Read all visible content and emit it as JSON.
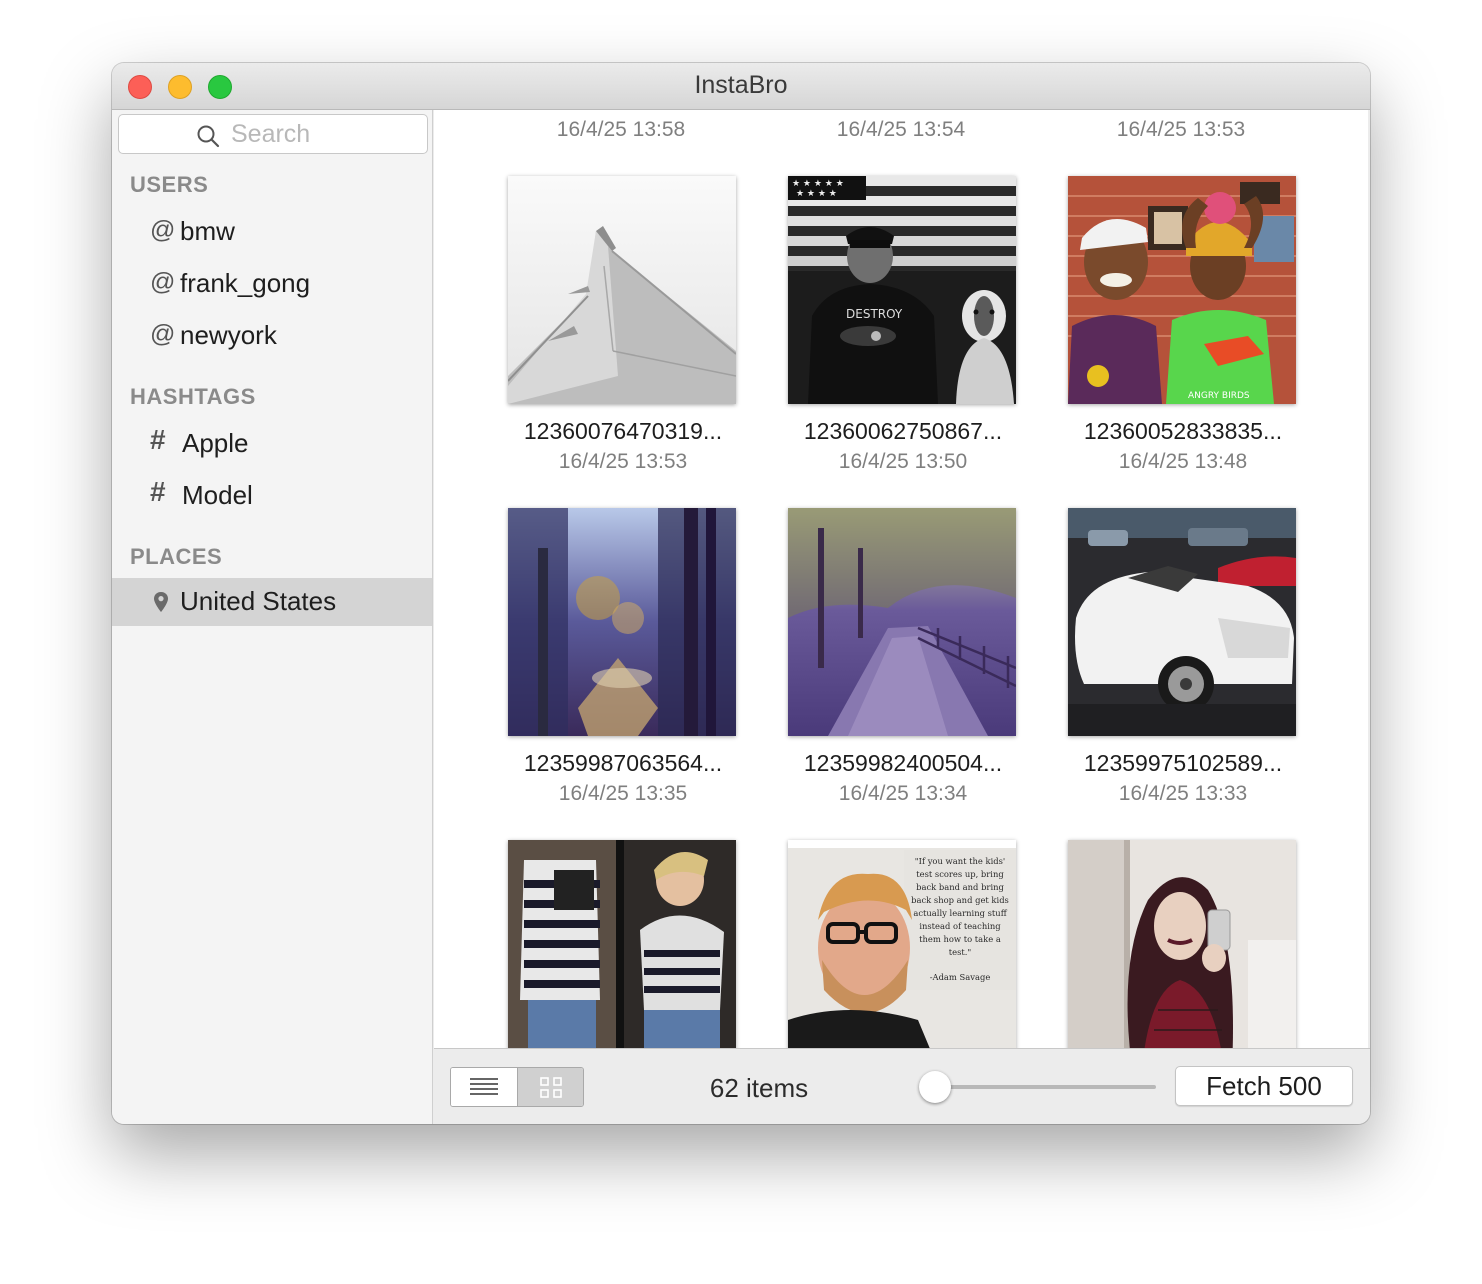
{
  "window": {
    "title": "InstaBro"
  },
  "search": {
    "placeholder": "Search"
  },
  "sidebar": {
    "sections": [
      {
        "header": "USERS",
        "items": [
          {
            "prefix": "@",
            "label": "bmw",
            "icon": "at-icon"
          },
          {
            "prefix": "@",
            "label": "frank_gong",
            "icon": "at-icon"
          },
          {
            "prefix": "@",
            "label": "newyork",
            "icon": "at-icon"
          }
        ]
      },
      {
        "header": "HASHTAGS",
        "items": [
          {
            "prefix": "#",
            "label": "Apple",
            "icon": "hash-icon"
          },
          {
            "prefix": "#",
            "label": "Model",
            "icon": "hash-icon"
          }
        ]
      },
      {
        "header": "PLACES",
        "items": [
          {
            "label": "United States",
            "icon": "location-pin-icon",
            "selected": true
          }
        ]
      }
    ]
  },
  "grid": {
    "previous_row_dates": [
      "16/4/25 13:58",
      "16/4/25 13:54",
      "16/4/25 13:53"
    ],
    "items": [
      {
        "caption": "12360076470319...",
        "date": "16/4/25 13:53",
        "image": "airplane-wing-photo"
      },
      {
        "caption": "12360062750867...",
        "date": "16/4/25 13:50",
        "image": "man-with-dog-flag-photo"
      },
      {
        "caption": "12360052833835...",
        "date": "16/4/25 13:48",
        "image": "two-boys-photo"
      },
      {
        "caption": "12359987063564...",
        "date": "16/4/25 13:35",
        "image": "forest-stream-photo"
      },
      {
        "caption": "12359982400504...",
        "date": "16/4/25 13:34",
        "image": "forest-path-photo"
      },
      {
        "caption": "12359975102589...",
        "date": "16/4/25 13:33",
        "image": "white-car-photo"
      },
      {
        "caption": "",
        "date": "",
        "image": "flag-tank-top-photo"
      },
      {
        "caption": "",
        "date": "",
        "image": "quote-portrait-photo"
      },
      {
        "caption": "",
        "date": "",
        "image": "woman-selfie-photo"
      }
    ]
  },
  "quote": {
    "lines": [
      "\"If you want the kids'",
      "test scores up, bring",
      "back band and bring",
      "back shop and get kids",
      "actually learning stuff",
      "instead of teaching",
      "them how to take a",
      "test.\""
    ],
    "author": "-Adam Savage"
  },
  "shirt_text": "DESTROY",
  "bottom_bar": {
    "view_modes": [
      {
        "name": "list-view-icon",
        "selected": false
      },
      {
        "name": "grid-view-icon",
        "selected": true
      }
    ],
    "item_count": "62 items",
    "slider_value": 0,
    "fetch_label": "Fetch 500"
  }
}
